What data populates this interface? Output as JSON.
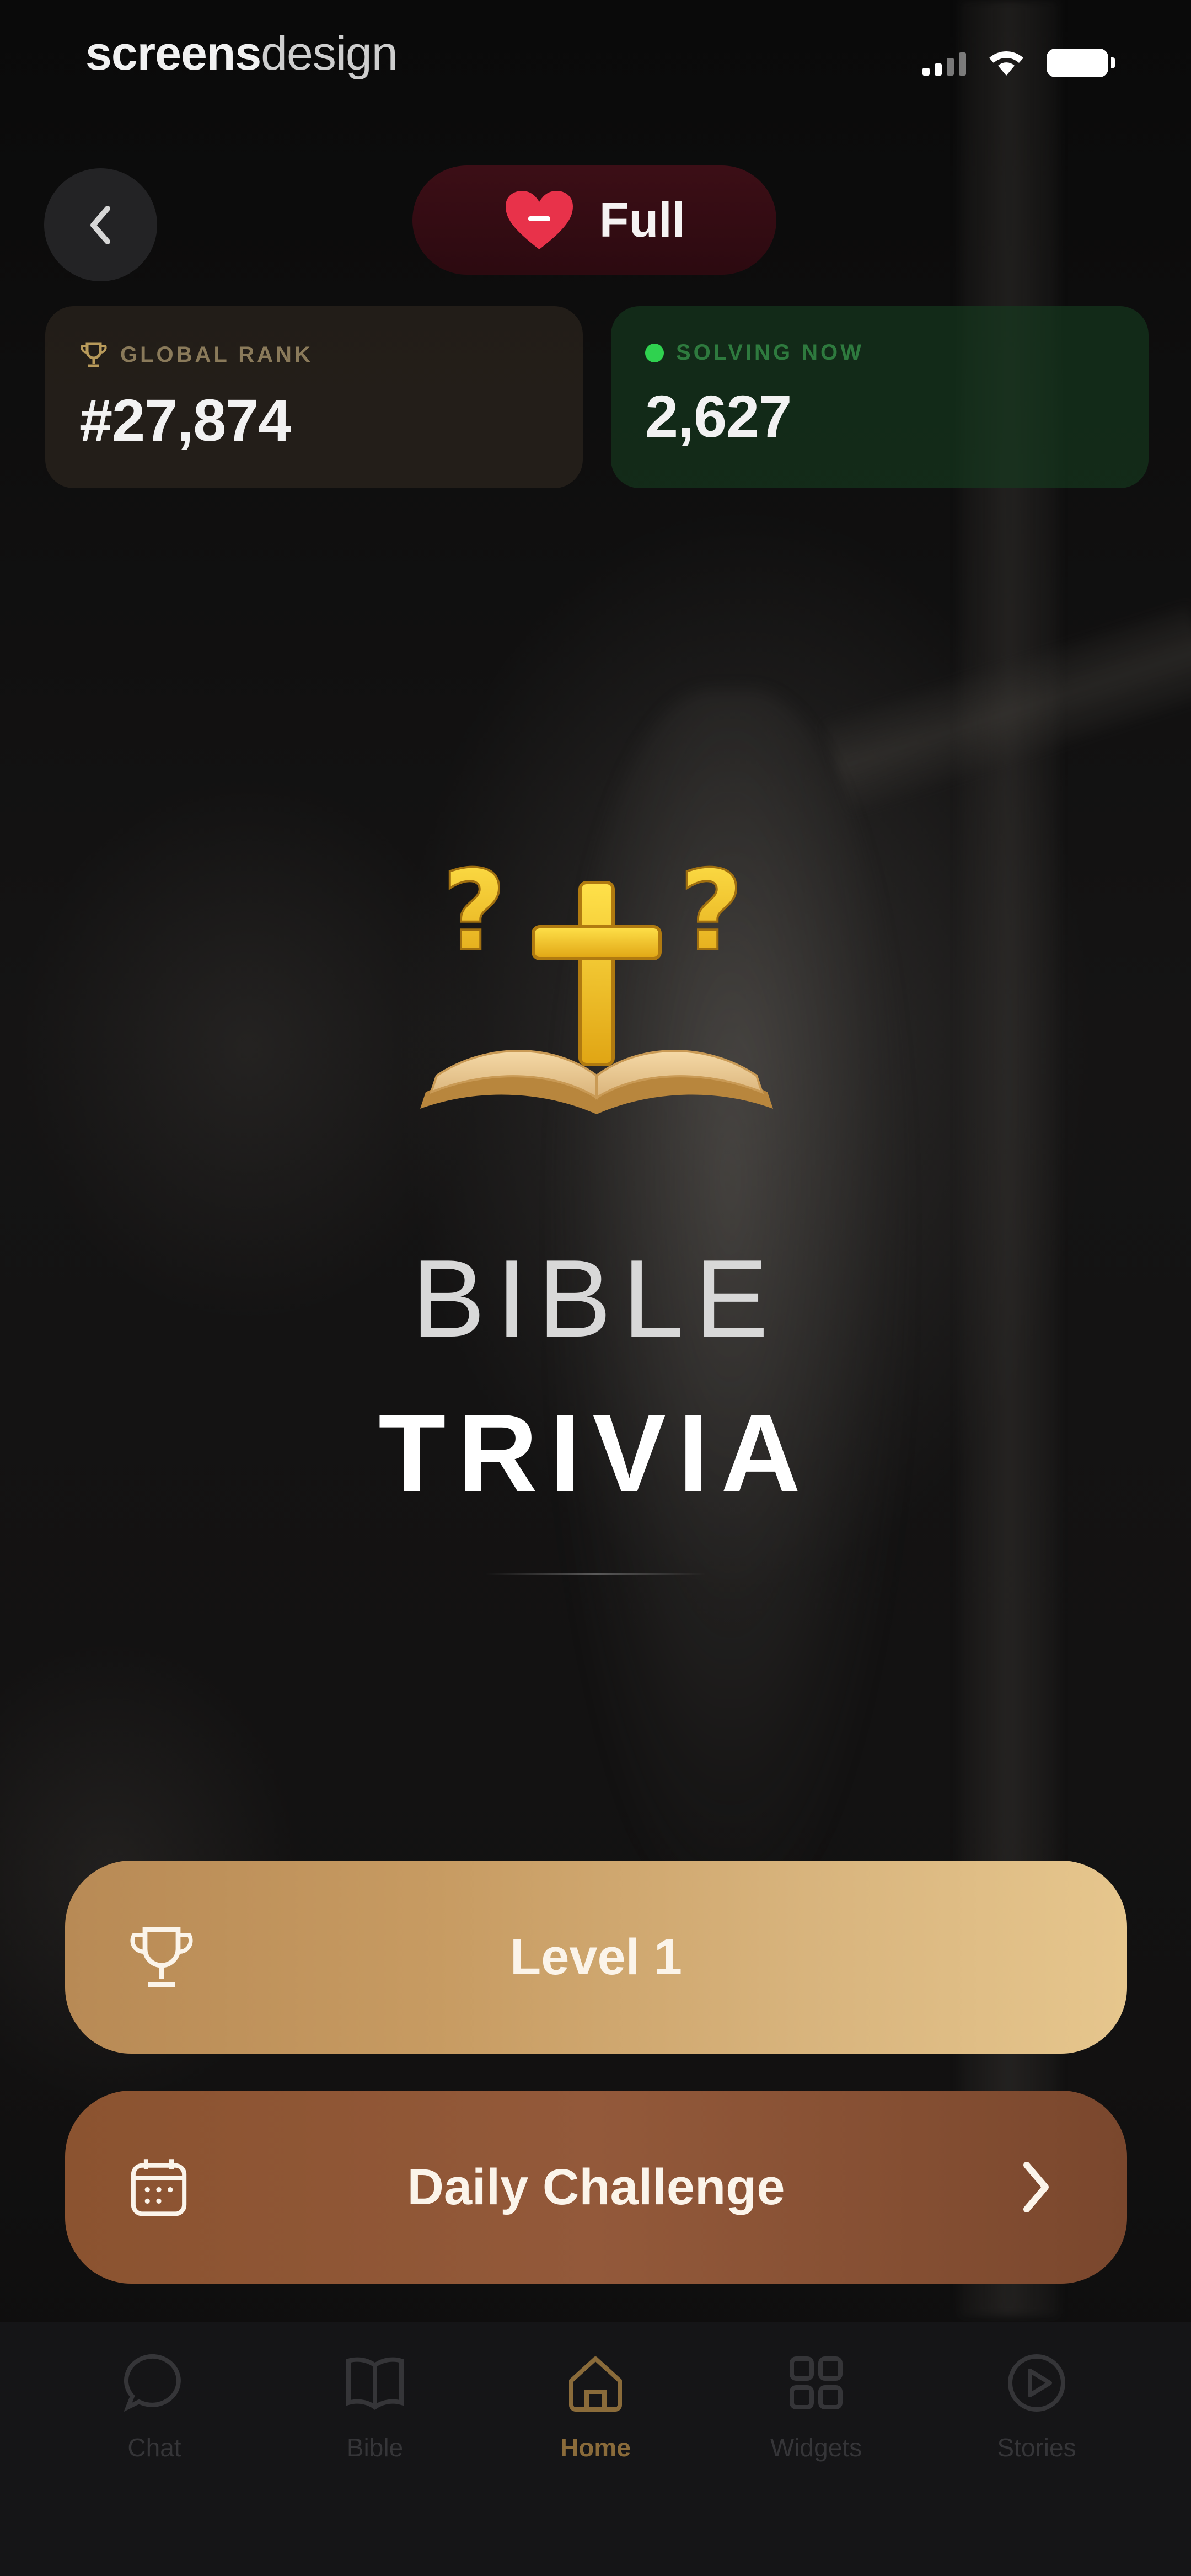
{
  "status_bar": {
    "watermark_bold": "screens",
    "watermark_light": "design"
  },
  "header": {
    "back_icon": "chevron-left-icon",
    "hearts_icon": "heart-icon",
    "hearts_status": "Full"
  },
  "stats": {
    "global_rank": {
      "label": "GLOBAL RANK",
      "value": "#27,874",
      "icon": "trophy-icon"
    },
    "solving_now": {
      "label": "SOLVING NOW",
      "value": "2,627",
      "icon": "online-dot-icon"
    }
  },
  "hero": {
    "icon": "bible-cross-question-icon",
    "title_line1": "BIBLE",
    "title_line2": "TRIVIA"
  },
  "actions": {
    "level": {
      "label": "Level 1",
      "icon": "trophy-icon"
    },
    "daily": {
      "label": "Daily Challenge",
      "icon": "calendar-icon",
      "trailing_icon": "chevron-right-icon"
    }
  },
  "tabs": [
    {
      "label": "Chat",
      "icon": "chat-bubble-icon",
      "active": false
    },
    {
      "label": "Bible",
      "icon": "open-book-icon",
      "active": false
    },
    {
      "label": "Home",
      "icon": "home-icon",
      "active": true
    },
    {
      "label": "Widgets",
      "icon": "widgets-grid-icon",
      "active": false
    },
    {
      "label": "Stories",
      "icon": "play-circle-icon",
      "active": false
    }
  ],
  "colors": {
    "accent_gold": "#d8b47d",
    "daily_brown": "#8b5330",
    "hearts_red": "#e8324a",
    "online_green": "#2fd24f",
    "active_tab": "#8a6b3a"
  }
}
